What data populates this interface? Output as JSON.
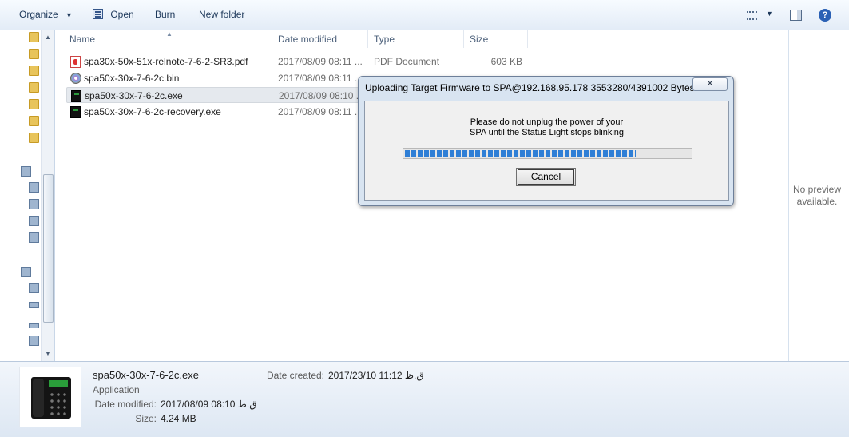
{
  "toolbar": {
    "organize_label": "Organize",
    "open_label": "Open",
    "burn_label": "Burn",
    "new_folder_label": "New folder",
    "help_glyph": "?"
  },
  "columns": {
    "name": "Name",
    "date_modified": "Date modified",
    "type": "Type",
    "size": "Size"
  },
  "files": [
    {
      "name": "spa30x-50x-51x-relnote-7-6-2-SR3.pdf",
      "date": "2017/08/09 08:11 ...",
      "type": "PDF Document",
      "size": "603 KB",
      "icon": "pdf-icon"
    },
    {
      "name": "spa50x-30x-7-6-2c.bin",
      "date": "2017/08/09 08:11 ...",
      "type": "",
      "size": "",
      "icon": "disc-icon"
    },
    {
      "name": "spa50x-30x-7-6-2c.exe",
      "date": "2017/08/09 08:10 ...",
      "type": "",
      "size": "",
      "icon": "phone-app-icon",
      "selected": true
    },
    {
      "name": "spa50x-30x-7-6-2c-recovery.exe",
      "date": "2017/08/09 08:11 ...",
      "type": "",
      "size": "",
      "icon": "phone-app-icon"
    }
  ],
  "preview": {
    "line1": "No preview",
    "line2": "available."
  },
  "details": {
    "name": "spa50x-30x-7-6-2c.exe",
    "type": "Application",
    "modified_label": "Date modified:",
    "modified_value": "2017/08/09 ق.ظ 08:10",
    "size_label": "Size:",
    "size_value": "4.24 MB",
    "created_label": "Date created:",
    "created_value": "2017/23/10 ق.ظ 11:12"
  },
  "dialog": {
    "title": "Uploading Target Firmware to SPA@192.168.95.178 3553280/4391002 Bytes",
    "close_glyph": "✕",
    "message_line1": "Please do not unplug the power of your",
    "message_line2": "SPA until the Status Light stops blinking",
    "progress": 0.81,
    "cancel_label": "Cancel"
  }
}
